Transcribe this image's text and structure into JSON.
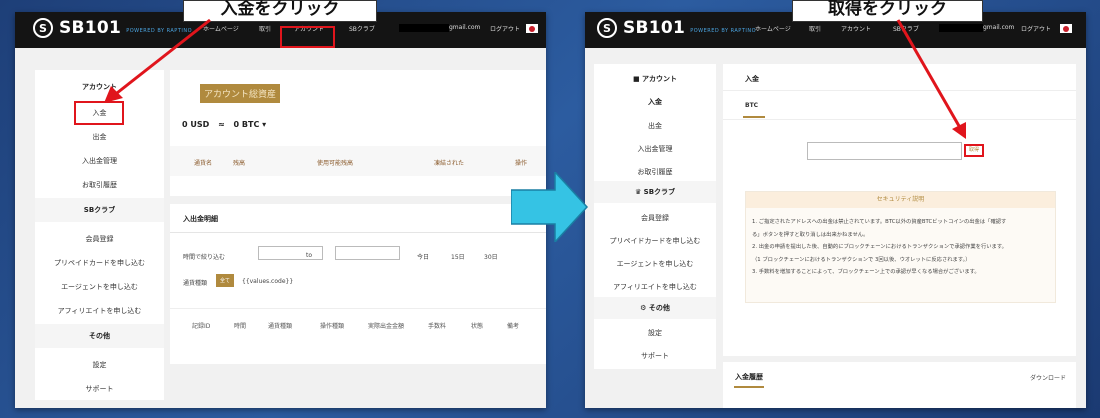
{
  "callouts": {
    "left": "入金をクリック",
    "right": "取得をクリック"
  },
  "nav": {
    "brand": "SB101",
    "powered": "POWERED BY RAPTINO",
    "home": "ホームページ",
    "trade": "取引",
    "account": "アカウント",
    "club": "SBクラブ",
    "email": "gmail.com",
    "logout": "ログアウト"
  },
  "side": {
    "account": "アカウント",
    "deposit": "入金",
    "withdraw": "出金",
    "manage": "入出金管理",
    "history": "お取引履歴",
    "club": "SBクラブ",
    "member": "会員登録",
    "prepaid": "プリペイドカードを申し込む",
    "agent": "エージェントを申し込む",
    "affiliate": "アフィリエイトを申し込む",
    "other": "その他",
    "settings": "設定",
    "support": "サポート"
  },
  "left": {
    "assets_title": "アカウント総資産",
    "balance_usd": "0 USD",
    "approx": "≈",
    "balance_btc": "0 BTC ▾",
    "asset_cols": [
      "通貨名",
      "残高",
      "使用可能残高",
      "凍結された",
      "操作"
    ],
    "detail_title": "入出金明細",
    "period_label": "時間で絞り込む",
    "to": "to",
    "q_today": "今日",
    "q_15": "15日",
    "q_30": "30日",
    "type_label": "通貨種類",
    "all": "全て",
    "code": "{{values.code}}",
    "detail_cols": [
      "記録ID",
      "時間",
      "通貨種類",
      "操作種類",
      "実際出金金額",
      "手数料",
      "状態",
      "備考"
    ]
  },
  "right": {
    "title": "入金",
    "tab": "BTC",
    "get_btn": "取得",
    "sec_title": "セキュリティ説明",
    "notes": [
      "1. ご指定されたアドレスへの出金は禁止されています。BTC以外の資産BTCビットコインの出金は「確認す",
      "る」ボタンを押すと取り消しは出来かねません。",
      "2. 出金の申請を提出した後、自動的にブロックチェーンにおけるトランザクションで承認作業を行います。",
      "（1 ブロックチェーンにおけるトランザクションで 3回以後、ウオレットに反応されます。）",
      "3. 手数料を増加することによって、ブロックチェーン上での承認が早くなる場合がございます。"
    ],
    "history": "入金履歴",
    "download": "ダウンロード"
  },
  "colors": {
    "accent_gold": "#b08a3e",
    "red": "#e0151c",
    "arrow_cyan": "#35c3e4"
  }
}
